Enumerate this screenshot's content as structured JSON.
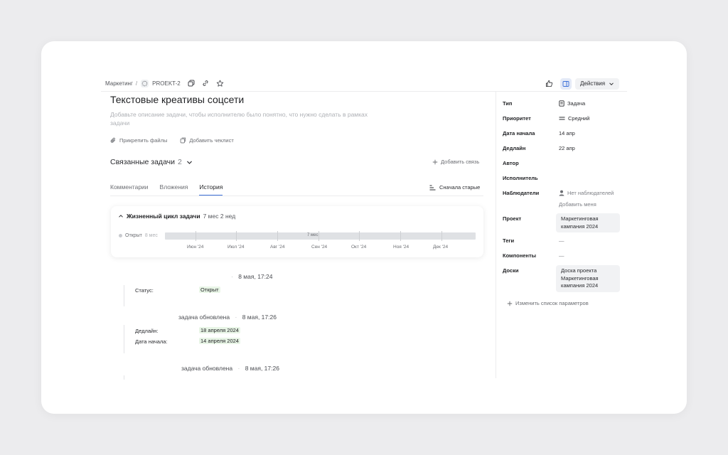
{
  "breadcrumb": {
    "project": "Маркетинг",
    "separator": "/",
    "task_key": "PROEKT-2"
  },
  "toolbar": {
    "actions_label": "Действия"
  },
  "task": {
    "title": "Текстовые креативы соцсети",
    "description_placeholder": "Добавьте описание задачи, чтобы исполнителю было понятно, что нужно сделать в рамках задачи",
    "attach_files": "Прикрепить файлы",
    "add_checklist": "Добавить чеклист"
  },
  "related": {
    "label": "Связанные задачи",
    "count": "2",
    "add_link": "Добавить связь"
  },
  "tabs": {
    "items": [
      {
        "label": "Комментарии",
        "active": false
      },
      {
        "label": "Вложения",
        "active": false
      },
      {
        "label": "История",
        "active": true
      }
    ],
    "sort_label": "Сначала старые"
  },
  "lifecycle": {
    "title": "Жизненный цикл задачи",
    "duration": "7 мес 2 нед",
    "state": "Открыт",
    "state_duration": "8 мес",
    "bar_label": "7 мес",
    "months": [
      "Июн '24",
      "Июл '24",
      "Авг '24",
      "Сен '24",
      "Окт '24",
      "Ноя '24",
      "Дек '24"
    ]
  },
  "history": {
    "separator": "·",
    "entries": [
      {
        "title": "",
        "time": "8 мая, 17:24",
        "fields": [
          {
            "key": "Статус:",
            "value": "Открыт"
          }
        ]
      },
      {
        "title": "задача обновлена",
        "time": "8 мая, 17:26",
        "fields": [
          {
            "key": "Дедлайн:",
            "value": "18 апреля 2024"
          },
          {
            "key": "Дата начала:",
            "value": "14 апреля 2024"
          }
        ]
      },
      {
        "title": "задача обновлена",
        "time": "8 мая, 17:26",
        "fields": []
      }
    ]
  },
  "params": {
    "type_key": "Тип",
    "type_value": "Задача",
    "priority_key": "Приоритет",
    "priority_value": "Средний",
    "start_key": "Дата начала",
    "start_value": "14 апр",
    "deadline_key": "Дедлайн",
    "deadline_value": "22 апр",
    "author_key": "Автор",
    "assignee_key": "Исполнитель",
    "watchers_key": "Наблюдатели",
    "watchers_value": "Нет наблюдателей",
    "add_me": "Добавить меня",
    "project_key": "Проект",
    "project_value": "Маркетинговая кампания 2024",
    "tags_key": "Теги",
    "tags_value": "—",
    "components_key": "Компоненты",
    "components_value": "—",
    "boards_key": "Доски",
    "boards_value": "Доска проекта Маркетинговая кампания 2024",
    "change_params": "Изменить список параметров"
  },
  "colors": {
    "accent": "#3b6fd8",
    "highlight_green": "#e8f5e6",
    "page_bg": "#ececee"
  }
}
